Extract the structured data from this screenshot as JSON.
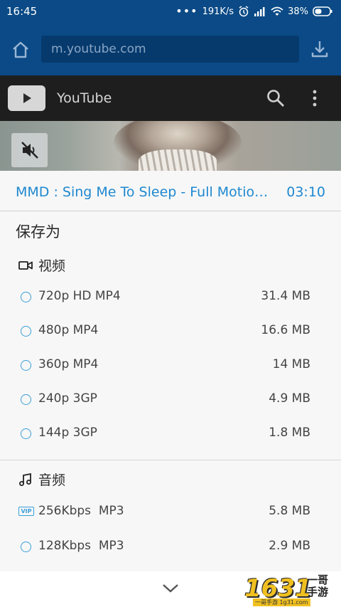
{
  "status_bar": {
    "time": "16:45",
    "network_speed": "191K/s",
    "battery": "38%"
  },
  "browser": {
    "url": "m.youtube.com"
  },
  "youtube": {
    "title": "YouTube"
  },
  "sheet": {
    "video_title": "MMD : Sing Me To Sleep - Full Motion Dance",
    "duration": "03:10",
    "save_as_label": "保存为",
    "video_section": {
      "label": "视频",
      "options": [
        {
          "label": "720p HD MP4",
          "size": "31.4 MB"
        },
        {
          "label": "480p MP4",
          "size": "16.6 MB"
        },
        {
          "label": "360p MP4",
          "size": "14 MB"
        },
        {
          "label": "240p 3GP",
          "size": "4.9 MB"
        },
        {
          "label": "144p 3GP",
          "size": "1.8 MB"
        }
      ]
    },
    "audio_section": {
      "label": "音频",
      "options": [
        {
          "label": "256Kbps  MP3",
          "size": "5.8 MB",
          "vip": "VIP"
        },
        {
          "label": "128Kbps  MP3",
          "size": "2.9 MB"
        }
      ]
    }
  },
  "watermark": {
    "number": "1631",
    "text": "一哥手游",
    "sub": "一哥手游 1g31.com"
  },
  "colors": {
    "accent": "#1e88d0",
    "status_bar_bg": "#0b4a86"
  }
}
